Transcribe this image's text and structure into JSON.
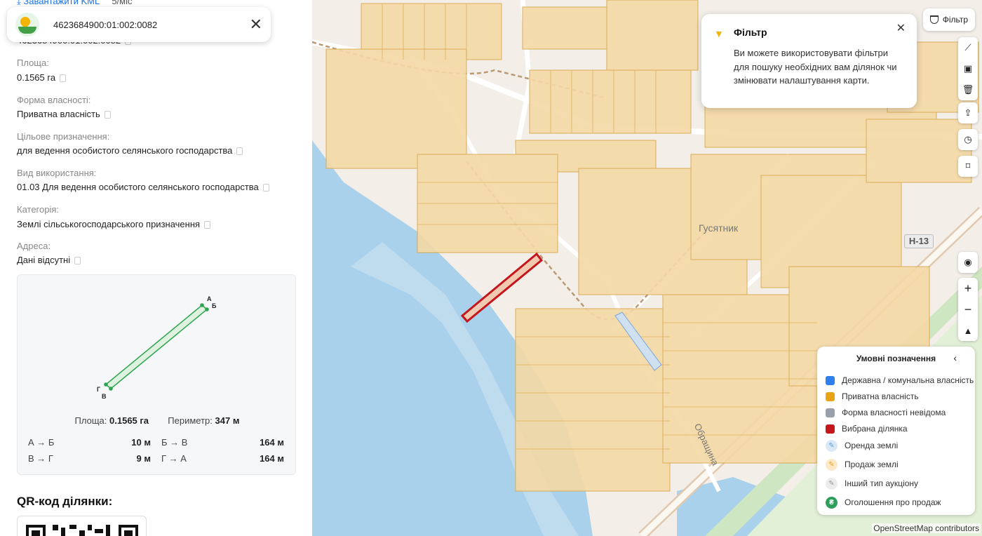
{
  "panel": {
    "kml_download": "Завантажити KML",
    "kml_size": "5/міс",
    "cadastral_number": "4623684900:01:002:0082",
    "cadastral_number_ghost": "4623684900:01:002:0082",
    "fields": [
      {
        "label": "Площа:",
        "value": "0.1565 га"
      },
      {
        "label": "Форма власності:",
        "value": "Приватна власність"
      },
      {
        "label": "Цільове призначення:",
        "value": "для ведення особистого селянського господарства"
      },
      {
        "label": "Вид використання:",
        "value": "01.03 Для ведення особистого селянського господарства"
      },
      {
        "label": "Категорія:",
        "value": "Землі сільськогосподарського призначення"
      },
      {
        "label": "Адреса:",
        "value": "Дані відсутні"
      }
    ],
    "shape": {
      "vertices": [
        "А",
        "Б",
        "В",
        "Г"
      ],
      "area_label": "Площа:",
      "area_value": "0.1565 га",
      "perimeter_label": "Периметр:",
      "perimeter_value": "347 м",
      "sides": [
        {
          "label": "А → Б",
          "value": "10 м"
        },
        {
          "label": "Б → В",
          "value": "164 м"
        },
        {
          "label": "В → Г",
          "value": "9 м"
        },
        {
          "label": "Г → А",
          "value": "164 м"
        }
      ]
    },
    "qr_title": "QR-код ділянки:"
  },
  "map": {
    "filter_button": "Фільтр",
    "filter_tip": {
      "title": "Фільтр",
      "text": "Ви можете використовувати фільтри для пошуку необхідних вам ділянок чи змінювати налаштування карти."
    },
    "place_label": "Гусятник",
    "road_label": "Н-13",
    "street_label": "Обращина",
    "legend": {
      "title": "Умовні позначення",
      "items": [
        {
          "label": "Державна / комунальна власність",
          "color": "#2f80ed"
        },
        {
          "label": "Приватна власність",
          "color": "#e8a317"
        },
        {
          "label": "Форма власності невідома",
          "color": "#9aa0ab"
        },
        {
          "label": "Вибрана ділянка",
          "color": "#c4161c"
        },
        {
          "label": "Оренда землі",
          "color": "#5b9bd5"
        },
        {
          "label": "Продаж землі",
          "color": "#f0a020"
        },
        {
          "label": "Інший тип аукціону",
          "color": "#b0b0b0"
        },
        {
          "label": "Оголошення про продаж",
          "color": "#2e9e5b"
        }
      ]
    },
    "attribution": "OpenStreetMap contributors",
    "tools": [
      "ruler-icon",
      "polygon-icon",
      "trash-icon",
      "share-icon",
      "history-icon",
      "bookmark-icon",
      "locate-icon",
      "zoom-in-icon",
      "zoom-out-icon",
      "compass-icon"
    ]
  }
}
